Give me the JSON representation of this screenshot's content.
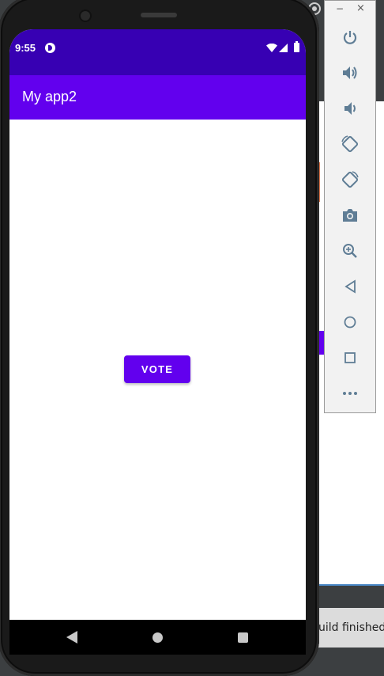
{
  "app": {
    "title": "My app2",
    "vote_label": "VOTE"
  },
  "status_bar": {
    "time": "9:55"
  },
  "ide": {
    "build_status": "uild finished"
  },
  "toolbar": {
    "minimize": "−",
    "close": "×",
    "buttons": [
      {
        "name": "power-icon"
      },
      {
        "name": "volume-up-icon"
      },
      {
        "name": "volume-down-icon"
      },
      {
        "name": "rotate-left-icon"
      },
      {
        "name": "rotate-right-icon"
      },
      {
        "name": "camera-icon"
      },
      {
        "name": "zoom-icon"
      },
      {
        "name": "back-icon"
      },
      {
        "name": "home-icon"
      },
      {
        "name": "overview-icon"
      },
      {
        "name": "more-icon"
      }
    ]
  },
  "colors": {
    "status_bar": "#3700b3",
    "app_bar": "#6200ee",
    "button": "#6200ee",
    "toolbar_icon": "#5f7d95"
  }
}
